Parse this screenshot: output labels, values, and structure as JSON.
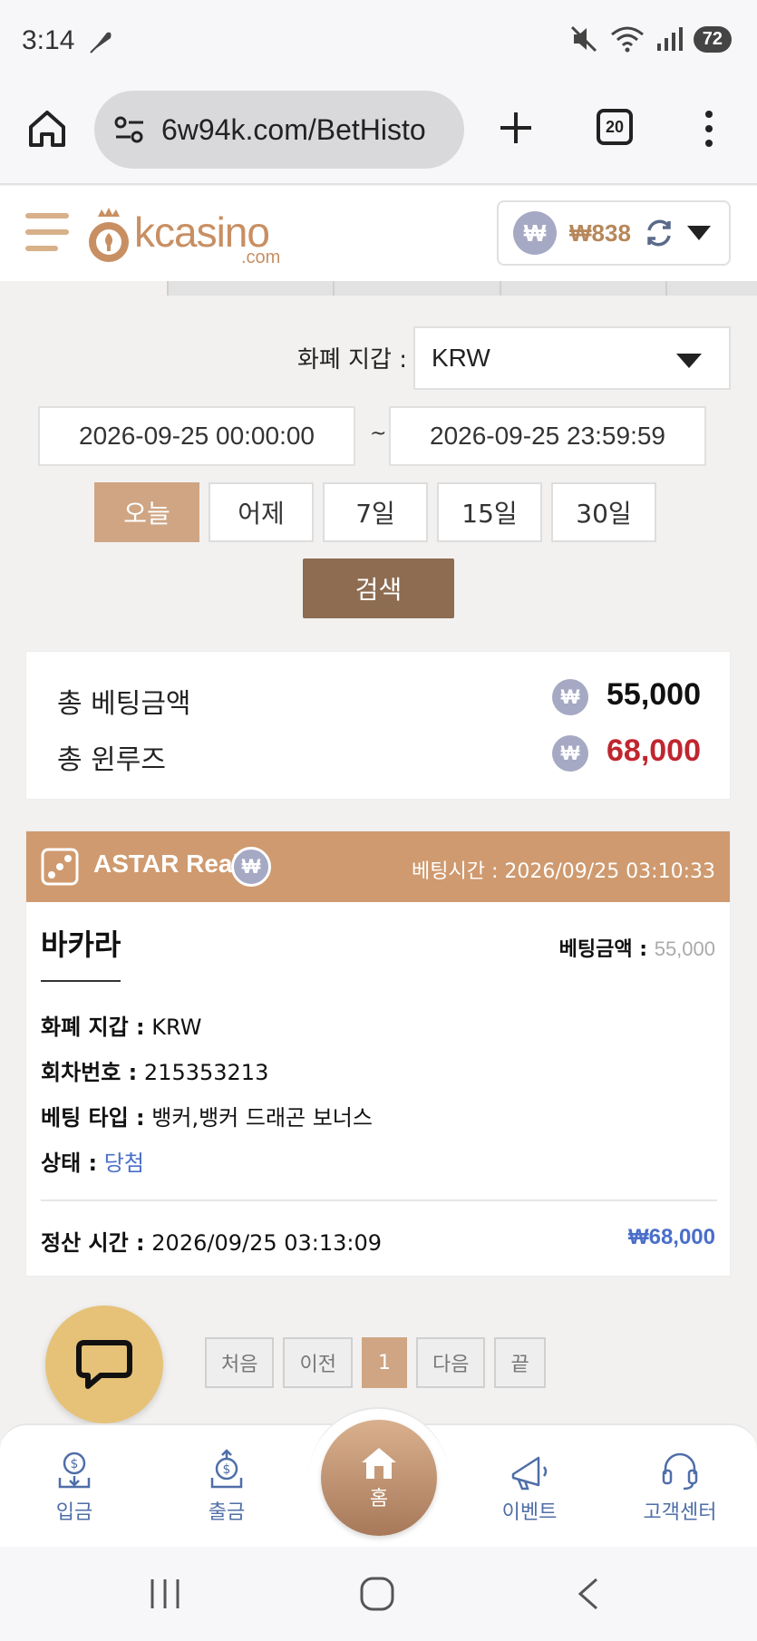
{
  "status_bar": {
    "time": "3:14",
    "battery": "72"
  },
  "browser": {
    "url": "6w94k.com/BetHisto",
    "tab_count": "20"
  },
  "header": {
    "logo_text": "kcasino",
    "logo_sub": ".com",
    "wallet_currency_symbol": "₩",
    "wallet_amount": "₩838"
  },
  "filter": {
    "currency_label": "화폐 지갑 :",
    "currency_value": "KRW",
    "date_start": "2026-09-25 00:00:00",
    "date_separator": "~",
    "date_end": "2026-09-25 23:59:59",
    "ranges": [
      "오늘",
      "어제",
      "7일",
      "15일",
      "30일"
    ],
    "active_range": "오늘",
    "search_label": "검색"
  },
  "summary": {
    "total_bet_label": "총 베팅금액",
    "total_bet_value": "55,000",
    "total_winloss_label": "총 윈루즈",
    "total_winloss_value": "68,000"
  },
  "bet_card": {
    "provider": "ASTAR Real",
    "bet_time_label": "베팅시간 :",
    "bet_time": "2026/09/25 03:10:33",
    "game": "바카라",
    "bet_amount_label": "베팅금액 :",
    "bet_amount": "55,000",
    "currency_label": "화폐 지갑 :",
    "currency": "KRW",
    "round_label": "회차번호 :",
    "round": "215353213",
    "type_label": "베팅 타입 :",
    "type": "뱅커,뱅커 드래곤 보너스",
    "status_label": "상태 :",
    "status": "당첨",
    "settle_label": "정산 시간 :",
    "settle_time": "2026/09/25 03:13:09",
    "settle_amount": "₩68,000"
  },
  "pagination": {
    "first": "처음",
    "prev": "이전",
    "current": "1",
    "next": "다음",
    "last": "끝"
  },
  "bottom_nav": {
    "deposit": "입금",
    "withdraw": "출금",
    "home": "홈",
    "event": "이벤트",
    "support": "고객센터"
  },
  "colors": {
    "accent": "#cf9a6f",
    "dark_brown": "#8d6c52",
    "red": "#c0262f",
    "blue": "#4a6fc9"
  }
}
